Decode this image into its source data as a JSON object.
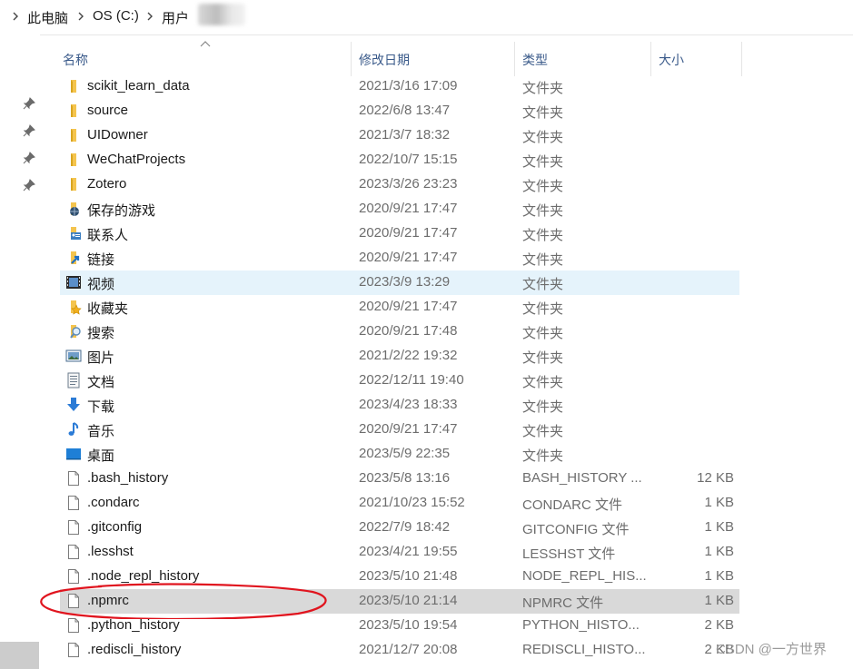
{
  "breadcrumb": {
    "items": [
      "此电脑",
      "OS (C:)",
      "用户"
    ]
  },
  "columns": {
    "name": "名称",
    "date": "修改日期",
    "type": "类型",
    "size": "大小"
  },
  "rows": [
    {
      "name": "scikit_learn_data",
      "date": "2021/3/16 17:09",
      "type": "文件夹",
      "size": "",
      "icon": "folder-icon"
    },
    {
      "name": "source",
      "date": "2022/6/8 13:47",
      "type": "文件夹",
      "size": "",
      "icon": "folder-icon"
    },
    {
      "name": "UIDowner",
      "date": "2021/3/7 18:32",
      "type": "文件夹",
      "size": "",
      "icon": "folder-icon"
    },
    {
      "name": "WeChatProjects",
      "date": "2022/10/7 15:15",
      "type": "文件夹",
      "size": "",
      "icon": "folder-icon"
    },
    {
      "name": "Zotero",
      "date": "2023/3/26 23:23",
      "type": "文件夹",
      "size": "",
      "icon": "folder-icon"
    },
    {
      "name": "保存的游戏",
      "date": "2020/9/21 17:47",
      "type": "文件夹",
      "size": "",
      "icon": "saved-games-icon"
    },
    {
      "name": "联系人",
      "date": "2020/9/21 17:47",
      "type": "文件夹",
      "size": "",
      "icon": "contacts-icon"
    },
    {
      "name": "链接",
      "date": "2020/9/21 17:47",
      "type": "文件夹",
      "size": "",
      "icon": "links-icon"
    },
    {
      "name": "视频",
      "date": "2023/3/9 13:29",
      "type": "文件夹",
      "size": "",
      "icon": "videos-icon"
    },
    {
      "name": "收藏夹",
      "date": "2020/9/21 17:47",
      "type": "文件夹",
      "size": "",
      "icon": "favorites-icon"
    },
    {
      "name": "搜索",
      "date": "2020/9/21 17:48",
      "type": "文件夹",
      "size": "",
      "icon": "searches-icon"
    },
    {
      "name": "图片",
      "date": "2021/2/22 19:32",
      "type": "文件夹",
      "size": "",
      "icon": "pictures-icon"
    },
    {
      "name": "文档",
      "date": "2022/12/11 19:40",
      "type": "文件夹",
      "size": "",
      "icon": "documents-icon"
    },
    {
      "name": "下载",
      "date": "2023/4/23 18:33",
      "type": "文件夹",
      "size": "",
      "icon": "downloads-icon"
    },
    {
      "name": "音乐",
      "date": "2020/9/21 17:47",
      "type": "文件夹",
      "size": "",
      "icon": "music-icon"
    },
    {
      "name": "桌面",
      "date": "2023/5/9 22:35",
      "type": "文件夹",
      "size": "",
      "icon": "desktop-icon"
    },
    {
      "name": ".bash_history",
      "date": "2023/5/8 13:16",
      "type": "BASH_HISTORY ...",
      "size": "12 KB",
      "icon": "file-icon"
    },
    {
      "name": ".condarc",
      "date": "2021/10/23 15:52",
      "type": "CONDARC 文件",
      "size": "1 KB",
      "icon": "file-icon"
    },
    {
      "name": ".gitconfig",
      "date": "2022/7/9 18:42",
      "type": "GITCONFIG 文件",
      "size": "1 KB",
      "icon": "file-icon"
    },
    {
      "name": ".lesshst",
      "date": "2023/4/21 19:55",
      "type": "LESSHST 文件",
      "size": "1 KB",
      "icon": "file-icon"
    },
    {
      "name": ".node_repl_history",
      "date": "2023/5/10 21:48",
      "type": "NODE_REPL_HIS...",
      "size": "1 KB",
      "icon": "file-icon"
    },
    {
      "name": ".npmrc",
      "date": "2023/5/10 21:14",
      "type": "NPMRC 文件",
      "size": "1 KB",
      "icon": "file-icon"
    },
    {
      "name": ".python_history",
      "date": "2023/5/10 19:54",
      "type": "PYTHON_HISTO...",
      "size": "2 KB",
      "icon": "file-icon"
    },
    {
      "name": ".rediscli_history",
      "date": "2021/12/7 20:08",
      "type": "REDISCLI_HISTO...",
      "size": "2 KB",
      "icon": "file-icon"
    }
  ],
  "watermark": "CSDN @一方世界",
  "colors": {
    "header_text": "#3a5a8a",
    "hover_row": "#e5f3fb",
    "selected_row": "#d9d9d9",
    "annotation": "#e0141e",
    "folder": "#f4c44e"
  }
}
